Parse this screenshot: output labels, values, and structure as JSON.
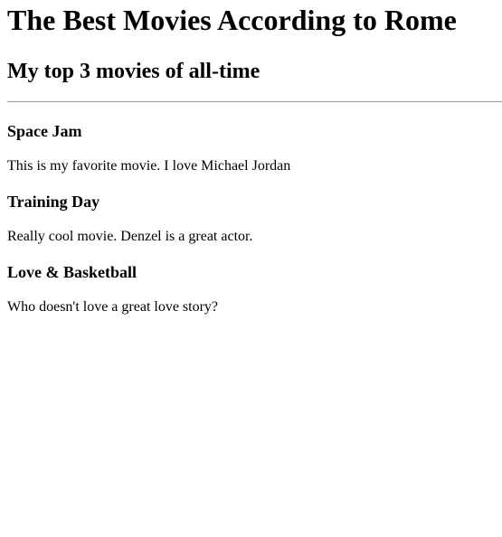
{
  "page": {
    "title": "The Best Movies According to Rome",
    "subtitle": "My top 3 movies of all-time"
  },
  "movies": [
    {
      "title": "Space Jam",
      "description": "This is my favorite movie. I love Michael Jordan"
    },
    {
      "title": "Training Day",
      "description": "Really cool movie. Denzel is a great actor."
    },
    {
      "title": "Love & Basketball",
      "description": "Who doesn't love a great love story?"
    }
  ]
}
